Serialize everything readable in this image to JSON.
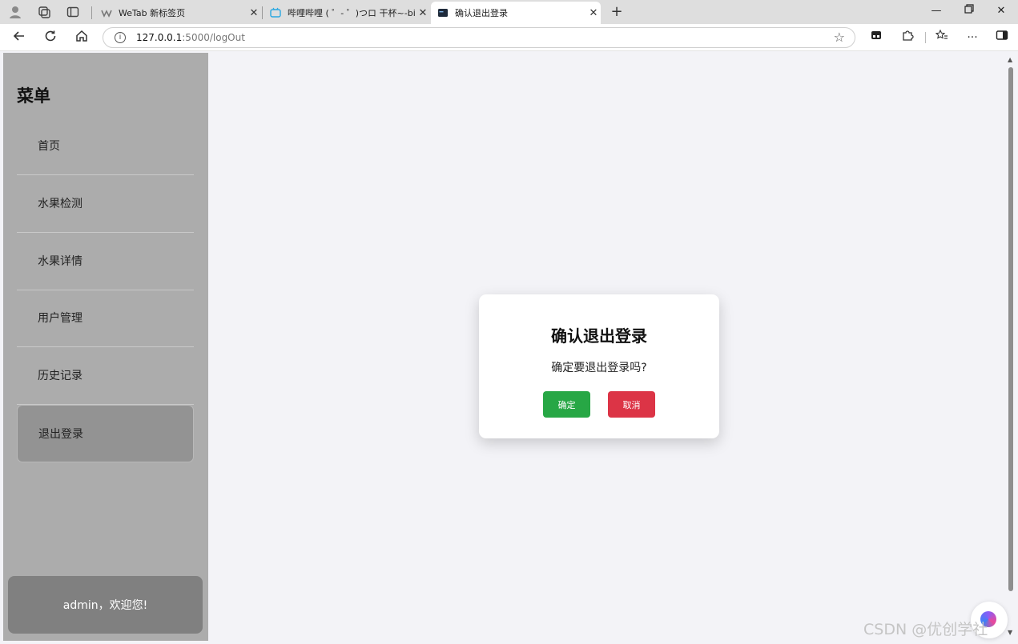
{
  "browser": {
    "tabs": [
      {
        "title": "WeTab 新标签页",
        "active": false
      },
      {
        "title": "哔哩哔哩 ( ゜- ゜)つロ 干杯~-bilibili",
        "active": false
      },
      {
        "title": "确认退出登录",
        "active": true
      }
    ],
    "url_host": "127.0.0.1",
    "url_path": ":5000/logOut"
  },
  "sidebar": {
    "title": "菜单",
    "items": [
      {
        "label": "首页"
      },
      {
        "label": "水果检测"
      },
      {
        "label": "水果详情"
      },
      {
        "label": "用户管理"
      },
      {
        "label": "历史记录"
      },
      {
        "label": "退出登录",
        "active": true
      }
    ],
    "user_greeting": "admin，欢迎您!"
  },
  "modal": {
    "title": "确认退出登录",
    "message": "确定要退出登录吗?",
    "confirm_label": "确定",
    "cancel_label": "取消"
  },
  "watermark": "CSDN @优创学社",
  "colors": {
    "confirm": "#27a745",
    "cancel": "#dc3446",
    "sidebar_bg": "#acacac",
    "active_item_bg": "#939393"
  }
}
